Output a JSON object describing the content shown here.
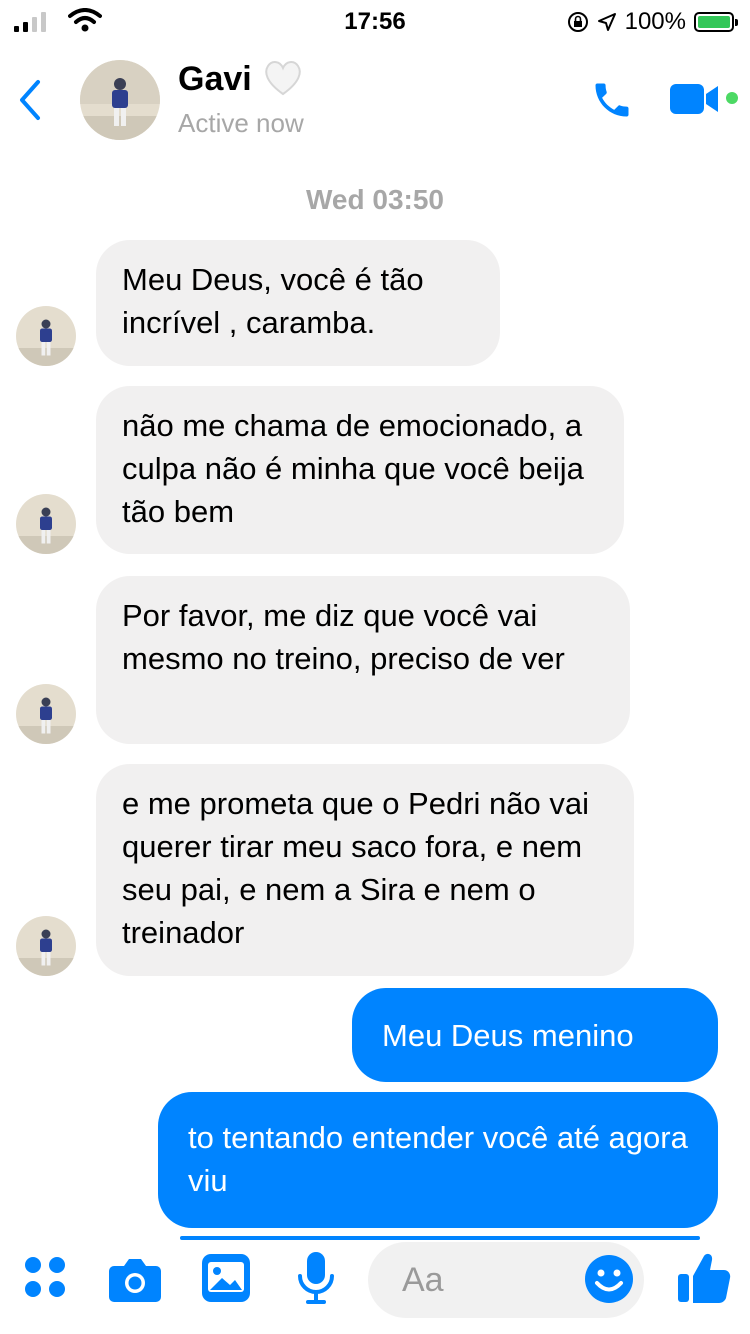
{
  "status_bar": {
    "time": "17:56",
    "battery": "100%"
  },
  "header": {
    "name": "Gavi",
    "presence": "Active now",
    "icons": [
      "back-chevron-icon",
      "white-heart-icon",
      "phone-icon",
      "video-camera-icon"
    ]
  },
  "conversation": {
    "timestamp": "Wed 03:50",
    "messages": [
      {
        "sender": "other",
        "text": "Meu Deus, você é tão incrível , caramba."
      },
      {
        "sender": "other",
        "text": "não me chama de emocionado, a culpa não é minha que você beija tão bem"
      },
      {
        "sender": "other",
        "text": "Por favor, me diz que você vai mesmo no treino, preciso de ver"
      },
      {
        "sender": "other",
        "text": "e me prometa que o Pedri não vai querer tirar meu saco fora, e nem seu pai, e nem a Sira e nem o treinador"
      },
      {
        "sender": "me",
        "text": "Meu Deus menino"
      },
      {
        "sender": "me",
        "text": "to tentando entender você até agora viu"
      }
    ]
  },
  "composer": {
    "placeholder": "Aa",
    "icons": [
      "apps-icon",
      "camera-icon",
      "image-icon",
      "microphone-icon",
      "emoji-icon",
      "thumbs-up-icon"
    ]
  },
  "colors": {
    "accent": "#0084ff",
    "incoming_bubble": "#f1f0f0",
    "muted_text": "#a7a7a7"
  }
}
